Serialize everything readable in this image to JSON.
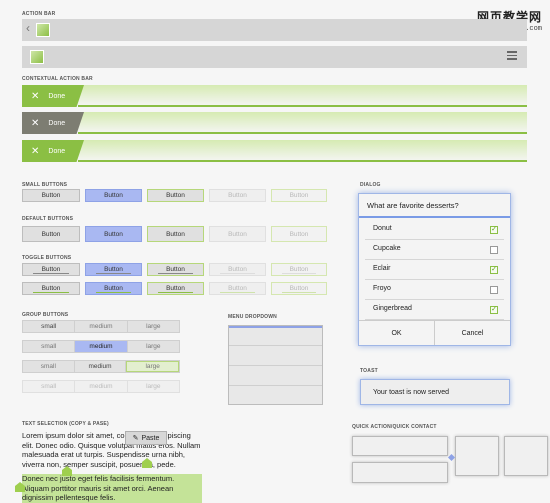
{
  "watermark": {
    "line1": "网页教学网",
    "line2": "www.webjx.com"
  },
  "sections": {
    "action_bar": "ACTION BAR",
    "contextual_action_bar": "CONTEXTUAL ACTION BAR",
    "small_buttons": "SMALL BUTTONS",
    "default_buttons": "DEFAULT BUTTONS",
    "toggle_buttons": "TOGGLE BUTTONS",
    "group_buttons": "GROUP BUTTONS",
    "menu_dropdown": "MENU DROPDOWN",
    "text_selection": "TEXT SELECTION (COPY & PASE)",
    "dialog": "DIALOG",
    "toast": "TOAST",
    "quick_action": "QUICK ACTION/QUICK CONTACT"
  },
  "contextual": {
    "done_label": "Done",
    "colors": [
      "#8bbf44",
      "#7d7d72",
      "#8bbf44"
    ]
  },
  "buttons": {
    "label": "Button",
    "states": [
      "normal",
      "pressed",
      "focused",
      "disabled",
      "disabled-focused"
    ]
  },
  "groups": {
    "items": [
      "small",
      "medium",
      "large"
    ]
  },
  "dialog": {
    "title": "What are favorite desserts?",
    "items": [
      {
        "label": "Donut",
        "checked": true
      },
      {
        "label": "Cupcake",
        "checked": false
      },
      {
        "label": "Eclair",
        "checked": true
      },
      {
        "label": "Froyo",
        "checked": false
      },
      {
        "label": "Gingerbread",
        "checked": true
      }
    ],
    "ok": "OK",
    "cancel": "Cancel"
  },
  "toast": {
    "message": "Your toast is now served"
  },
  "text_selection": {
    "paste_label": "Paste",
    "para1": "Lorem ipsum dolor sit amet, consectetur adipiscing elit. Donec odio. Quisque volutpat mattis eros. Nullam malesuada erat ut turpis. Suspendisse urna nibh, viverra non, semper suscipit, posuere a, pede.",
    "para2": "Donec nec justo eget felis facilisis fermentum. Aliquam porttitor mauris sit amet orci. Aenean dignissim pellentesque felis."
  }
}
